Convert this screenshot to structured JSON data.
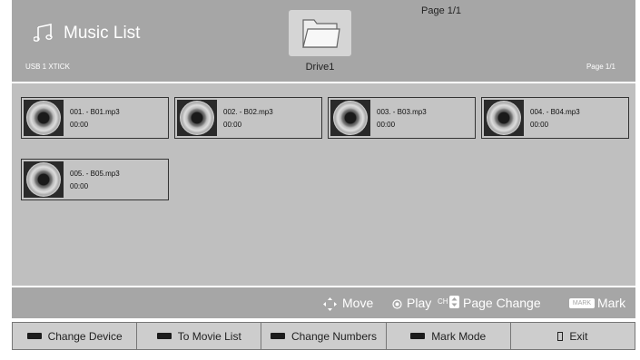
{
  "header": {
    "title": "Music List",
    "device": "USB 1 XTICK",
    "drive": "Drive1",
    "page_top": "Page 1/1",
    "page_right": "Page 1/1"
  },
  "files": [
    {
      "name": "001. - B01.mp3",
      "time": "00:00"
    },
    {
      "name": "002. - B02.mp3",
      "time": "00:00"
    },
    {
      "name": "003. - B03.mp3",
      "time": "00:00"
    },
    {
      "name": "004. - B04.mp3",
      "time": "00:00"
    },
    {
      "name": "005. - B05.mp3",
      "time": "00:00"
    }
  ],
  "hints": {
    "move": "Move",
    "play": "Play",
    "ch_label": "CH",
    "page_change": "Page Change",
    "mark_badge": "MARK",
    "mark": "Mark"
  },
  "buttons": {
    "change_device": "Change Device",
    "to_movie_list": "To Movie List",
    "change_numbers": "Change Numbers",
    "mark_mode": "Mark Mode",
    "exit": "Exit"
  },
  "icons": {
    "title": "music-note-icon",
    "folder": "folder-icon",
    "file": "cd-disc-icon",
    "move": "four-way-arrow-icon",
    "play": "ok-button-icon",
    "page": "ch-up-down-icon",
    "exit": "exit-icon"
  },
  "colors": {
    "header_bg": "#a6a6a6",
    "content_bg": "#bfbfbf",
    "button_swatch": "#1c1c1c"
  }
}
